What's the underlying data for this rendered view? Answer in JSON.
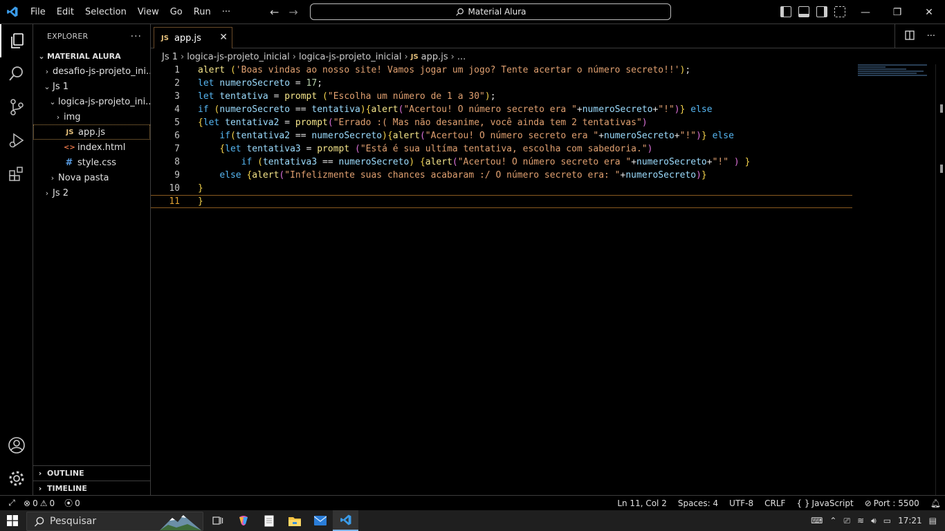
{
  "menu": [
    "File",
    "Edit",
    "Selection",
    "View",
    "Go",
    "Run",
    "···"
  ],
  "command_center": "Material Alura",
  "explorer": {
    "title": "EXPLORER",
    "root": "MATERIAL ALURA",
    "items": [
      {
        "label": "desafio-js-projeto_ini...",
        "indent": 1,
        "chev": "›",
        "type": "folder"
      },
      {
        "label": "Js 1",
        "indent": 1,
        "chev": "⌄",
        "type": "folder"
      },
      {
        "label": "logica-js-projeto_ini...",
        "indent": 2,
        "chev": "⌄",
        "type": "folder"
      },
      {
        "label": "img",
        "indent": 3,
        "chev": "›",
        "type": "folder"
      },
      {
        "label": "app.js",
        "indent": 3,
        "chev": "",
        "type": "js",
        "selected": true
      },
      {
        "label": "index.html",
        "indent": 3,
        "chev": "",
        "type": "html"
      },
      {
        "label": "style.css",
        "indent": 3,
        "chev": "",
        "type": "css"
      },
      {
        "label": "Nova pasta",
        "indent": 2,
        "chev": "›",
        "type": "folder"
      },
      {
        "label": "Js 2",
        "indent": 1,
        "chev": "›",
        "type": "folder"
      }
    ],
    "outline": "OUTLINE",
    "timeline": "TIMELINE"
  },
  "tab": {
    "label": "app.js",
    "icon": "JS",
    "close": "✕"
  },
  "breadcrumb": [
    "Js 1",
    "logica-js-projeto_inicial",
    "logica-js-projeto_inicial",
    "app.js",
    "..."
  ],
  "editor": {
    "current_line": 11,
    "lines": [
      "alert ('Boas vindas ao nosso site! Vamos jogar um jogo? Tente acertar o número secreto!!');",
      "let numeroSecreto = 17;",
      "let tentativa = prompt (\"Escolha um número de 1 a 30\");",
      "if (numeroSecreto == tentativa){alert(\"Acertou! O número secreto era \"+numeroSecreto+\"!\")} else",
      "{let tentativa2 = prompt(\"Errado :( Mas não desanime, você ainda tem 2 tentativas\")",
      "    if(tentativa2 == numeroSecreto){alert(\"Acertou! O número secreto era \"+numeroSecreto+\"!\")} else",
      "    {let tentativa3 = prompt (\"Está é sua ultíma tentativa, escolha com sabedoria.\")",
      "        if (tentativa3 == numeroSecreto) {alert(\"Acertou! O número secreto era \"+numeroSecreto+\"!\" ) }",
      "    else {alert(\"Infelizmente suas chances acabaram :/ O número secreto era: \"+numeroSecreto)}",
      "}",
      "}"
    ]
  },
  "status": {
    "errors": "0",
    "warnings": "0",
    "ports": "0",
    "position": "Ln 11, Col 2",
    "spaces": "Spaces: 4",
    "encoding": "UTF-8",
    "eol": "CRLF",
    "language": "JavaScript",
    "port": "Port : 5500"
  },
  "taskbar": {
    "search_placeholder": "Pesquisar",
    "time": "17:21"
  },
  "colors": {
    "keyword": "#56b6f2",
    "function": "#f5e58a",
    "string": "#e0a070",
    "variable": "#9cdcfe",
    "number": "#b5cea8",
    "current_line_border": "#8a5a20"
  }
}
